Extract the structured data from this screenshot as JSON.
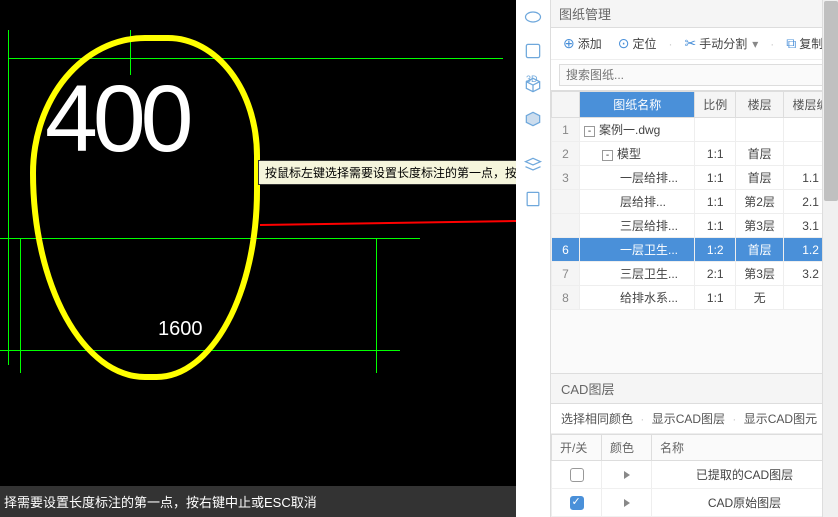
{
  "canvas": {
    "text_400": "400",
    "text_1600": "1600",
    "tooltip": "按鼠标左键选择需要设置长度标注的第一点，按右键中止或ESC取消",
    "status": "择需要设置长度标注的第一点，按右键中止或ESC取消"
  },
  "toolstrip": {
    "label_3d": "3D"
  },
  "drawing_panel": {
    "title": "图纸管理",
    "toolbar": {
      "add": "添加",
      "locate": "定位",
      "manual_split": "手动分割",
      "copy": "复制"
    },
    "search_placeholder": "搜索图纸...",
    "columns": {
      "name": "图纸名称",
      "scale": "比例",
      "floor": "楼层",
      "floor_no": "楼层编"
    },
    "rows": [
      {
        "idx": "1",
        "name": "案例一.dwg",
        "scale": "",
        "floor": "",
        "fn": "",
        "indent": 0,
        "expand": "-"
      },
      {
        "idx": "2",
        "name": "模型",
        "scale": "1:1",
        "floor": "首层",
        "fn": "",
        "indent": 1,
        "expand": "-"
      },
      {
        "idx": "3",
        "name": "一层给排...",
        "scale": "1:1",
        "floor": "首层",
        "fn": "1.1",
        "indent": 2
      },
      {
        "idx": "",
        "name": "层给排...",
        "scale": "1:1",
        "floor": "第2层",
        "fn": "2.1",
        "indent": 2
      },
      {
        "idx": "",
        "name": "三层给排...",
        "scale": "1:1",
        "floor": "第3层",
        "fn": "3.1",
        "indent": 2
      },
      {
        "idx": "6",
        "name": "一层卫生...",
        "scale": "1:2",
        "floor": "首层",
        "fn": "1.2",
        "indent": 2,
        "selected": true
      },
      {
        "idx": "7",
        "name": "三层卫生...",
        "scale": "2:1",
        "floor": "第3层",
        "fn": "3.2",
        "indent": 2
      },
      {
        "idx": "8",
        "name": "给排水系...",
        "scale": "1:1",
        "floor": "无",
        "fn": "",
        "indent": 2
      }
    ]
  },
  "layer_panel": {
    "title": "CAD图层",
    "toolbar": {
      "select_same": "选择相同颜色",
      "show_layer": "显示CAD图层",
      "show_elem": "显示CAD图元"
    },
    "columns": {
      "toggle": "开/关",
      "color": "颜色",
      "name": "名称"
    },
    "rows": [
      {
        "on": false,
        "name": "已提取的CAD图层"
      },
      {
        "on": true,
        "name": "CAD原始图层"
      }
    ]
  }
}
